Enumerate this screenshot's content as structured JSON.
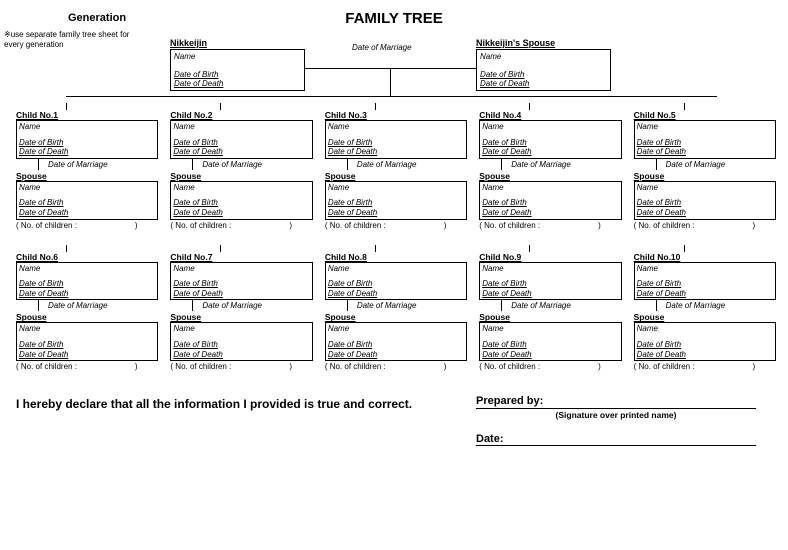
{
  "header": {
    "generation_label": "Generation",
    "title": "FAMILY TREE",
    "note": "※use separate family tree sheet for every generation"
  },
  "parents": {
    "left_title": "Nikkeijin",
    "right_title": "Nikkeijin's Spouse",
    "name_label": "Name",
    "dob_label": "Date of Birth",
    "dod_label": "Date of Death",
    "dom_label": "Date of Marriage"
  },
  "child_labels": {
    "name": "Name",
    "dob": "Date of Birth",
    "dod": "Date of Death",
    "dom": "Date of Marriage",
    "spouse": "Spouse",
    "noc_open": "( No. of children :",
    "noc_close": ")"
  },
  "children": [
    {
      "title": "Child No.1"
    },
    {
      "title": "Child No.2"
    },
    {
      "title": "Child No.3"
    },
    {
      "title": "Child No.4"
    },
    {
      "title": "Child No.5"
    },
    {
      "title": "Child No.6"
    },
    {
      "title": "Child No.7"
    },
    {
      "title": "Child No.8"
    },
    {
      "title": "Child No.9"
    },
    {
      "title": "Child No.10"
    }
  ],
  "footer": {
    "declaration": "I hereby declare that all the information I provided is true and correct.",
    "prepared_by": "Prepared by:",
    "signature_note": "(Signature over printed name)",
    "date_label": "Date:"
  }
}
